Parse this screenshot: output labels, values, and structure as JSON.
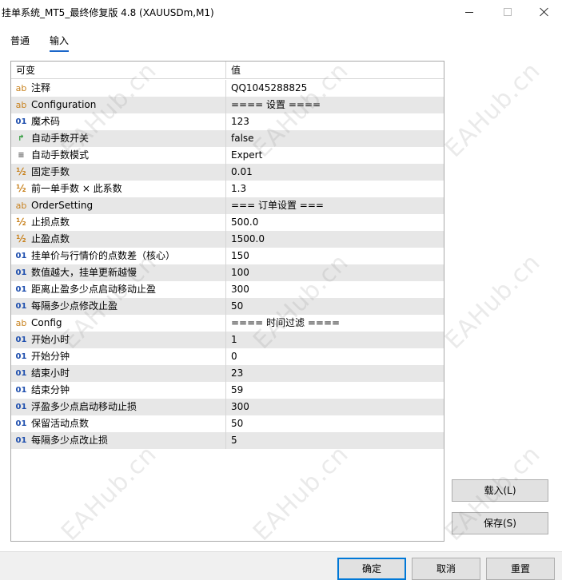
{
  "window": {
    "title": "挂单系统_MT5_最终修复版 4.8 (XAUUSDm,M1)",
    "controls": {
      "minimize": "",
      "maximize": "",
      "close": ""
    }
  },
  "tabs": [
    {
      "label": "普通",
      "active": false
    },
    {
      "label": "输入",
      "active": true
    }
  ],
  "grid": {
    "header": {
      "name": "可变",
      "value": "值"
    },
    "rows": [
      {
        "icon": "ab",
        "type": "string",
        "name": "注释",
        "value": "QQ1045288825"
      },
      {
        "icon": "ab",
        "type": "string",
        "name": "Configuration",
        "value": "==== 设置 ===="
      },
      {
        "icon": "01",
        "type": "integer",
        "name": "魔术码",
        "value": "123"
      },
      {
        "icon": "↱",
        "type": "bool",
        "name": "自动手数开关",
        "value": "false"
      },
      {
        "icon": "≡",
        "type": "enum",
        "name": "自动手数模式",
        "value": "Expert"
      },
      {
        "icon": "½",
        "type": "double",
        "name": "固定手数",
        "value": "0.01"
      },
      {
        "icon": "½",
        "type": "double",
        "name": "前一单手数 × 此系数",
        "value": "1.3"
      },
      {
        "icon": "ab",
        "type": "string",
        "name": "OrderSetting",
        "value": "=== 订单设置 ==="
      },
      {
        "icon": "½",
        "type": "double",
        "name": "止损点数",
        "value": "500.0"
      },
      {
        "icon": "½",
        "type": "double",
        "name": "止盈点数",
        "value": "1500.0"
      },
      {
        "icon": "01",
        "type": "integer",
        "name": "挂单价与行情价的点数差（核心）",
        "value": "150"
      },
      {
        "icon": "01",
        "type": "integer",
        "name": "数值越大，挂单更新越慢",
        "value": "100"
      },
      {
        "icon": "01",
        "type": "integer",
        "name": "距离止盈多少点启动移动止盈",
        "value": "300"
      },
      {
        "icon": "01",
        "type": "integer",
        "name": "每隔多少点修改止盈",
        "value": "50"
      },
      {
        "icon": "ab",
        "type": "string",
        "name": "Config",
        "value": "==== 时间过滤 ===="
      },
      {
        "icon": "01",
        "type": "integer",
        "name": "开始小时",
        "value": "1"
      },
      {
        "icon": "01",
        "type": "integer",
        "name": "开始分钟",
        "value": "0"
      },
      {
        "icon": "01",
        "type": "integer",
        "name": "结束小时",
        "value": "23"
      },
      {
        "icon": "01",
        "type": "integer",
        "name": "结束分钟",
        "value": "59"
      },
      {
        "icon": "01",
        "type": "integer",
        "name": "浮盈多少点启动移动止损",
        "value": "300"
      },
      {
        "icon": "01",
        "type": "integer",
        "name": "保留活动点数",
        "value": "50"
      },
      {
        "icon": "01",
        "type": "integer",
        "name": "每隔多少点改止损",
        "value": "5"
      }
    ]
  },
  "side_buttons": {
    "load": "载入(L)",
    "save": "保存(S)"
  },
  "footer": {
    "ok": "确定",
    "cancel": "取消",
    "reset": "重置"
  },
  "watermark": "EAHub.cn",
  "colors": {
    "accent": "#0078d7",
    "tab_underline": "#1a66c9",
    "row_alt": "#e7e7e7"
  }
}
